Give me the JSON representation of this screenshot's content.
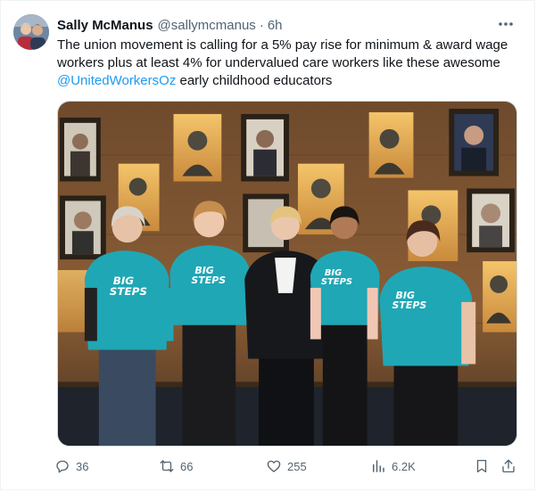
{
  "tweet": {
    "author_name": "Sally McManus",
    "author_handle": "@sallymcmanus",
    "separator": "·",
    "time_ago": "6h",
    "text_before": "The union movement is calling for a 5% pay rise for minimum & award wage workers plus at least 4% for undervalued care workers like these awesome ",
    "mention": "@UnitedWorkersOz",
    "text_after": " early childhood educators"
  },
  "media": {
    "shirt_text_line1": "BIG",
    "shirt_text_line2": "STEPS"
  },
  "actions": {
    "replies": "36",
    "reposts": "66",
    "likes": "255",
    "views": "6.2K"
  },
  "icons": {
    "more": "more-horizontal-icon",
    "reply": "reply-icon",
    "repost": "repost-icon",
    "like": "heart-icon",
    "views": "views-chart-icon",
    "bookmark": "bookmark-icon",
    "share": "share-icon"
  },
  "colors": {
    "link": "#1d9bf0",
    "muted": "#536471",
    "text": "#0f1419",
    "teal_shirt": "#1fa7b5"
  }
}
